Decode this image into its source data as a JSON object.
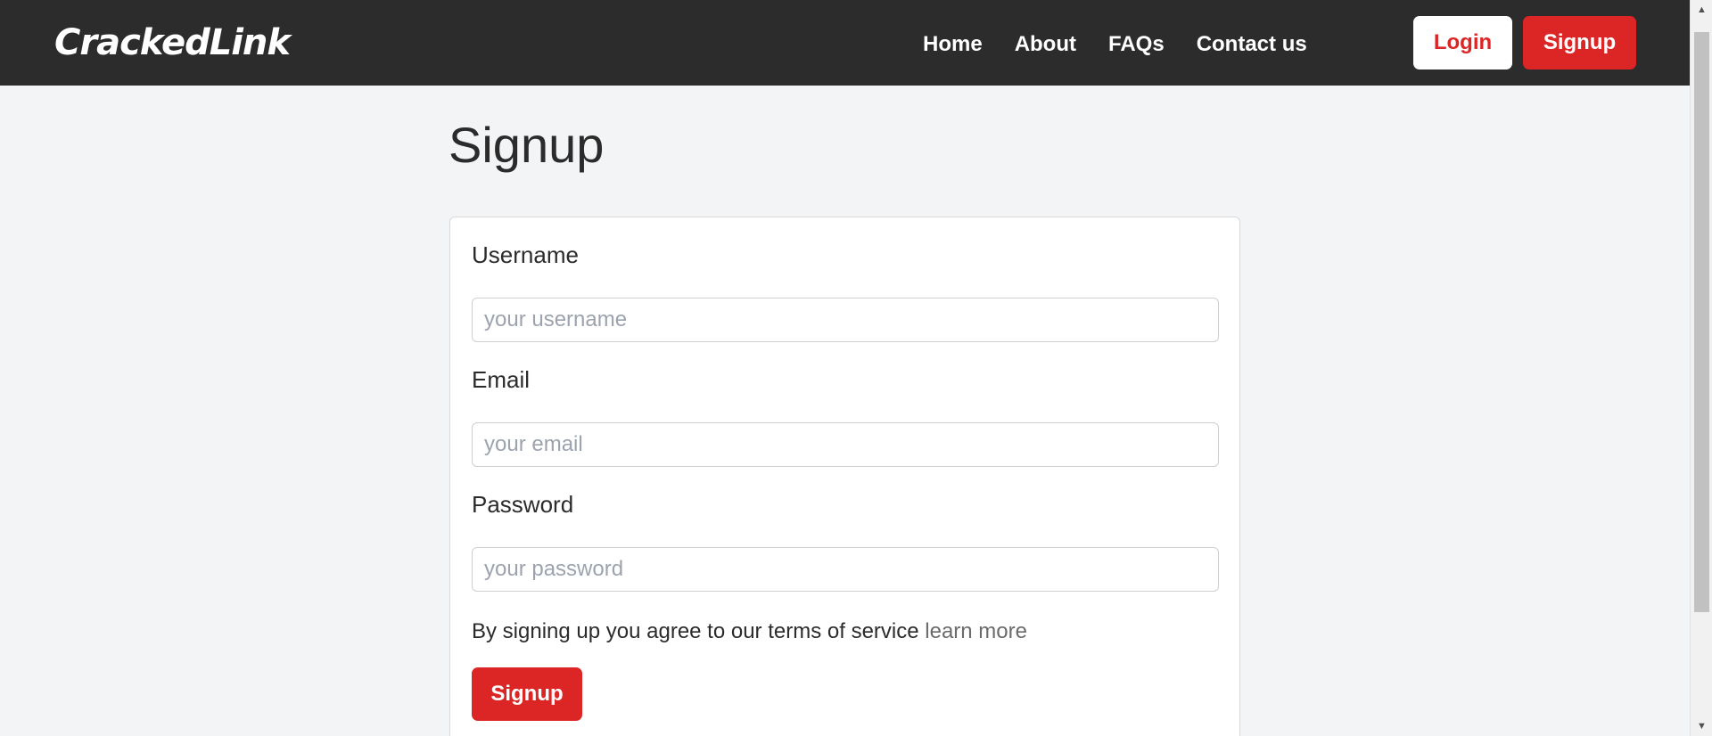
{
  "navbar": {
    "brand": "CrackedLink",
    "links": [
      "Home",
      "About",
      "FAQs",
      "Contact us"
    ],
    "login_label": "Login",
    "signup_label": "Signup"
  },
  "main": {
    "title": "Signup",
    "form": {
      "username": {
        "label": "Username",
        "placeholder": "your username"
      },
      "email": {
        "label": "Email",
        "placeholder": "your email"
      },
      "password": {
        "label": "Password",
        "placeholder": "your password"
      },
      "terms_text": "By signing up you agree to our terms of service",
      "terms_link": "learn more",
      "submit_label": "Signup"
    }
  },
  "scrollbar": {
    "up_icon": "scroll-up-arrow-icon",
    "down_icon": "scroll-down-arrow-icon"
  },
  "colors": {
    "navbar_bg": "#2c2c2c",
    "accent_red": "#dc2626",
    "page_bg": "#f3f4f6"
  }
}
